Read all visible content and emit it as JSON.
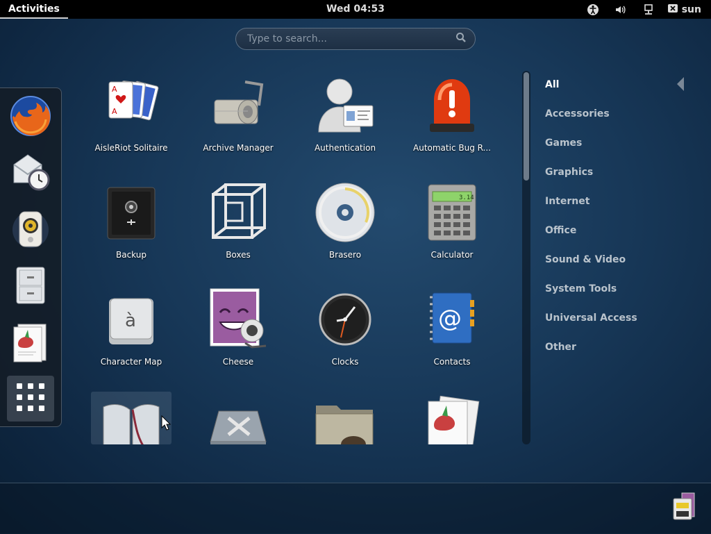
{
  "topbar": {
    "activities": "Activities",
    "clock": "Wed 04:53",
    "user": "sun"
  },
  "tray_icons": [
    "accessibility-icon",
    "volume-icon",
    "network-icon",
    "user-status-icon"
  ],
  "search": {
    "placeholder": "Type to search..."
  },
  "dash": {
    "items": [
      "firefox",
      "evolution-mail-and-calendar",
      "rhythmbox",
      "files",
      "document-viewer"
    ],
    "show_apps": "show-applications"
  },
  "apps": [
    {
      "label": "AisleRiot Solitaire",
      "icon": "cards-icon"
    },
    {
      "label": "Archive Manager",
      "icon": "archive-icon"
    },
    {
      "label": "Authentication",
      "icon": "authentication-icon"
    },
    {
      "label": "Automatic Bug R...",
      "icon": "alarm-light-icon"
    },
    {
      "label": "Backup",
      "icon": "safe-icon"
    },
    {
      "label": "Boxes",
      "icon": "boxes-icon"
    },
    {
      "label": "Brasero",
      "icon": "disc-icon"
    },
    {
      "label": "Calculator",
      "icon": "calculator-icon"
    },
    {
      "label": "Character Map",
      "icon": "character-map-icon"
    },
    {
      "label": "Cheese",
      "icon": "cheese-icon"
    },
    {
      "label": "Clocks",
      "icon": "clock-icon"
    },
    {
      "label": "Contacts",
      "icon": "contacts-icon"
    },
    {
      "label": "",
      "icon": "book-icon"
    },
    {
      "label": "",
      "icon": "disk-utility-icon"
    },
    {
      "label": "",
      "icon": "folder-icon"
    },
    {
      "label": "",
      "icon": "document-icon"
    }
  ],
  "calculator_display": "3.14",
  "character_map_glyph": "à",
  "categories": [
    {
      "label": "All",
      "active": true
    },
    {
      "label": "Accessories"
    },
    {
      "label": "Games"
    },
    {
      "label": "Graphics"
    },
    {
      "label": "Internet"
    },
    {
      "label": "Office"
    },
    {
      "label": "Sound & Video"
    },
    {
      "label": "System Tools"
    },
    {
      "label": "Universal Access"
    },
    {
      "label": "Other"
    }
  ],
  "colors": {
    "topbar": "#000000",
    "background": "#173757",
    "accent": "#ffffff"
  }
}
